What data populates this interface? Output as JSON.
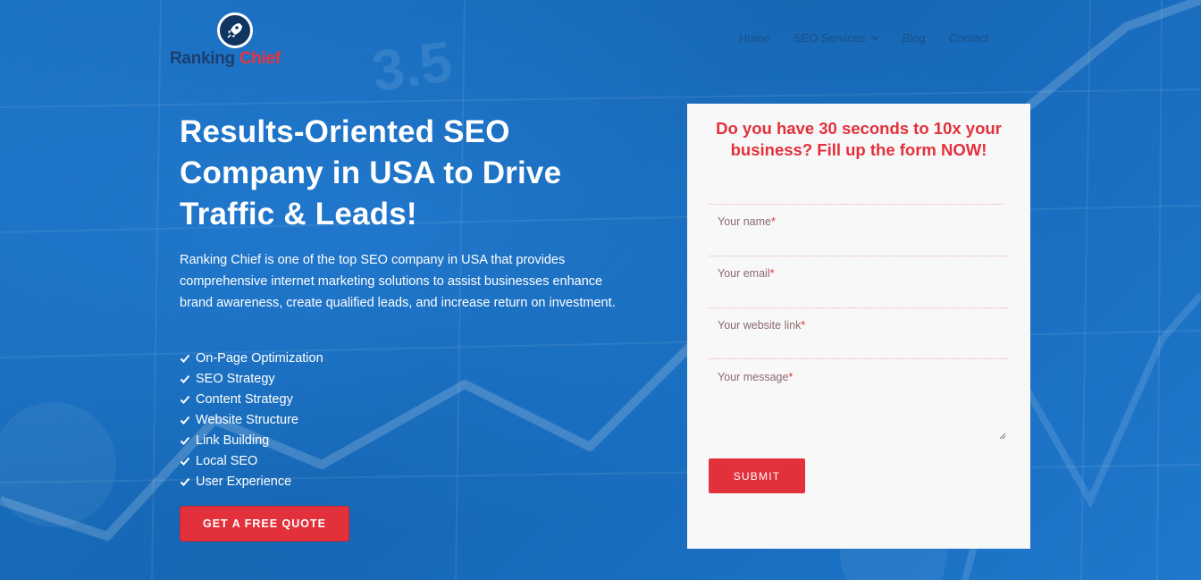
{
  "brand": {
    "name_part1": "Ranking",
    "name_part2": "Chief",
    "logo_icon": "rocket-icon",
    "colors": {
      "primary_blue": "#1a6fc0",
      "accent_red": "#e3313c",
      "logo_dark": "#1b3f6d"
    }
  },
  "nav": {
    "items": [
      {
        "label": "Home"
      },
      {
        "label": "SEO Services",
        "icon": "chevron-down-icon"
      },
      {
        "label": "Blog"
      },
      {
        "label": "Contact"
      }
    ]
  },
  "hero": {
    "title": "Results-Oriented SEO Company in USA to Drive Traffic & Leads!",
    "description": "Ranking Chief is one of the top SEO company in USA that provides comprehensive internet marketing solutions to assist businesses enhance brand awareness, create qualified leads, and increase return on investment.",
    "features": [
      "On-Page Optimization",
      "SEO Strategy",
      "Content Strategy",
      "Website Structure",
      "Link Building",
      "Local SEO",
      "User Experience"
    ],
    "feature_icon": "check-icon",
    "cta_label": "GET A FREE QUOTE"
  },
  "form": {
    "title": "Do you have 30 seconds to 10x your business? Fill up the form NOW!",
    "fields": [
      {
        "placeholder": "Your name",
        "required_mark": "*"
      },
      {
        "placeholder": "Your email",
        "required_mark": "*"
      },
      {
        "placeholder": "Your website link",
        "required_mark": "*"
      },
      {
        "placeholder": "Your message",
        "required_mark": "*"
      }
    ],
    "submit_label": "SUBMIT"
  },
  "background": {
    "overlay_text": "3.5"
  }
}
